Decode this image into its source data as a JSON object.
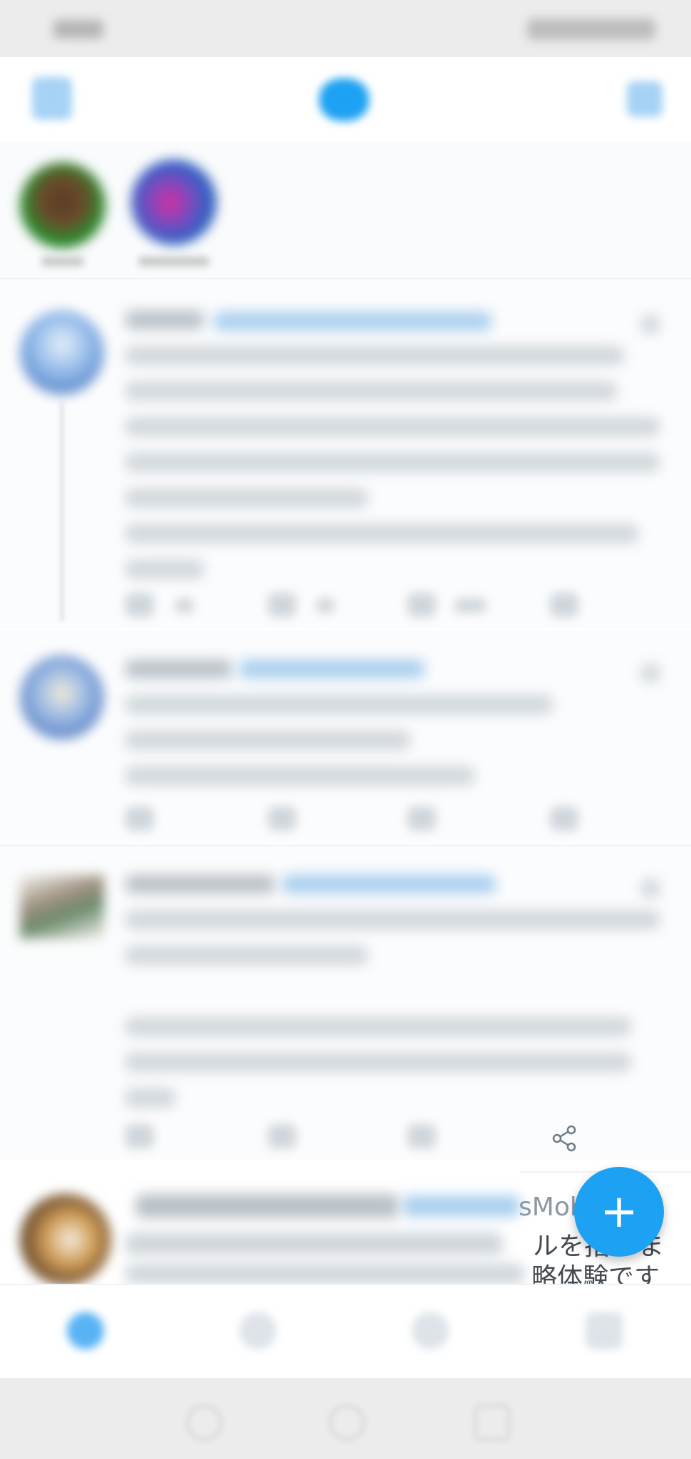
{
  "app": {
    "accent": "#1da1f2",
    "background": "#ffffff"
  },
  "icons": {
    "menu": "menu-icon",
    "logo": "bird-icon",
    "timeline": "sparkle-icon",
    "share": "share-icon",
    "compose": "plus-icon",
    "home": "home-icon",
    "search": "search-icon",
    "notifications": "bell-icon",
    "messages": "mail-icon"
  },
  "tweet4": {
    "handle_fragment": "sMob",
    "line2_fragment": "ルを指",
    "line2_tail": "ま",
    "line3_fragment": "略体験です"
  },
  "compose": {
    "label": "+"
  }
}
